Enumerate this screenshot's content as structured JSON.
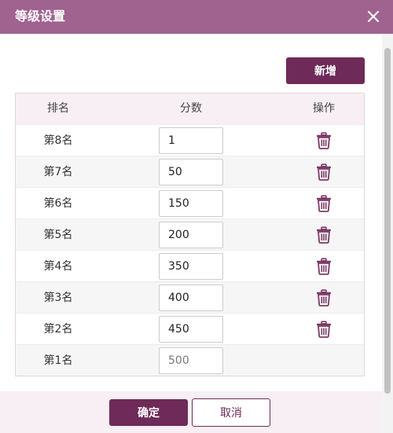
{
  "dialog": {
    "title": "等级设置"
  },
  "toolbar": {
    "add_label": "新增"
  },
  "table": {
    "headers": {
      "rank": "排名",
      "score": "分数",
      "action": "操作"
    },
    "rows": [
      {
        "rank": "第8名",
        "score": "1"
      },
      {
        "rank": "第7名",
        "score": "50"
      },
      {
        "rank": "第6名",
        "score": "150"
      },
      {
        "rank": "第5名",
        "score": "200"
      },
      {
        "rank": "第4名",
        "score": "350"
      },
      {
        "rank": "第3名",
        "score": "400"
      },
      {
        "rank": "第2名",
        "score": "450"
      },
      {
        "rank": "第1名",
        "score": "500"
      }
    ]
  },
  "footer": {
    "ok_label": "确定",
    "cancel_label": "取消"
  },
  "colors": {
    "header": "#a0628f",
    "primary": "#6e2a58",
    "table_header": "#f7eff3",
    "trash_icon": "#7b3a66"
  }
}
